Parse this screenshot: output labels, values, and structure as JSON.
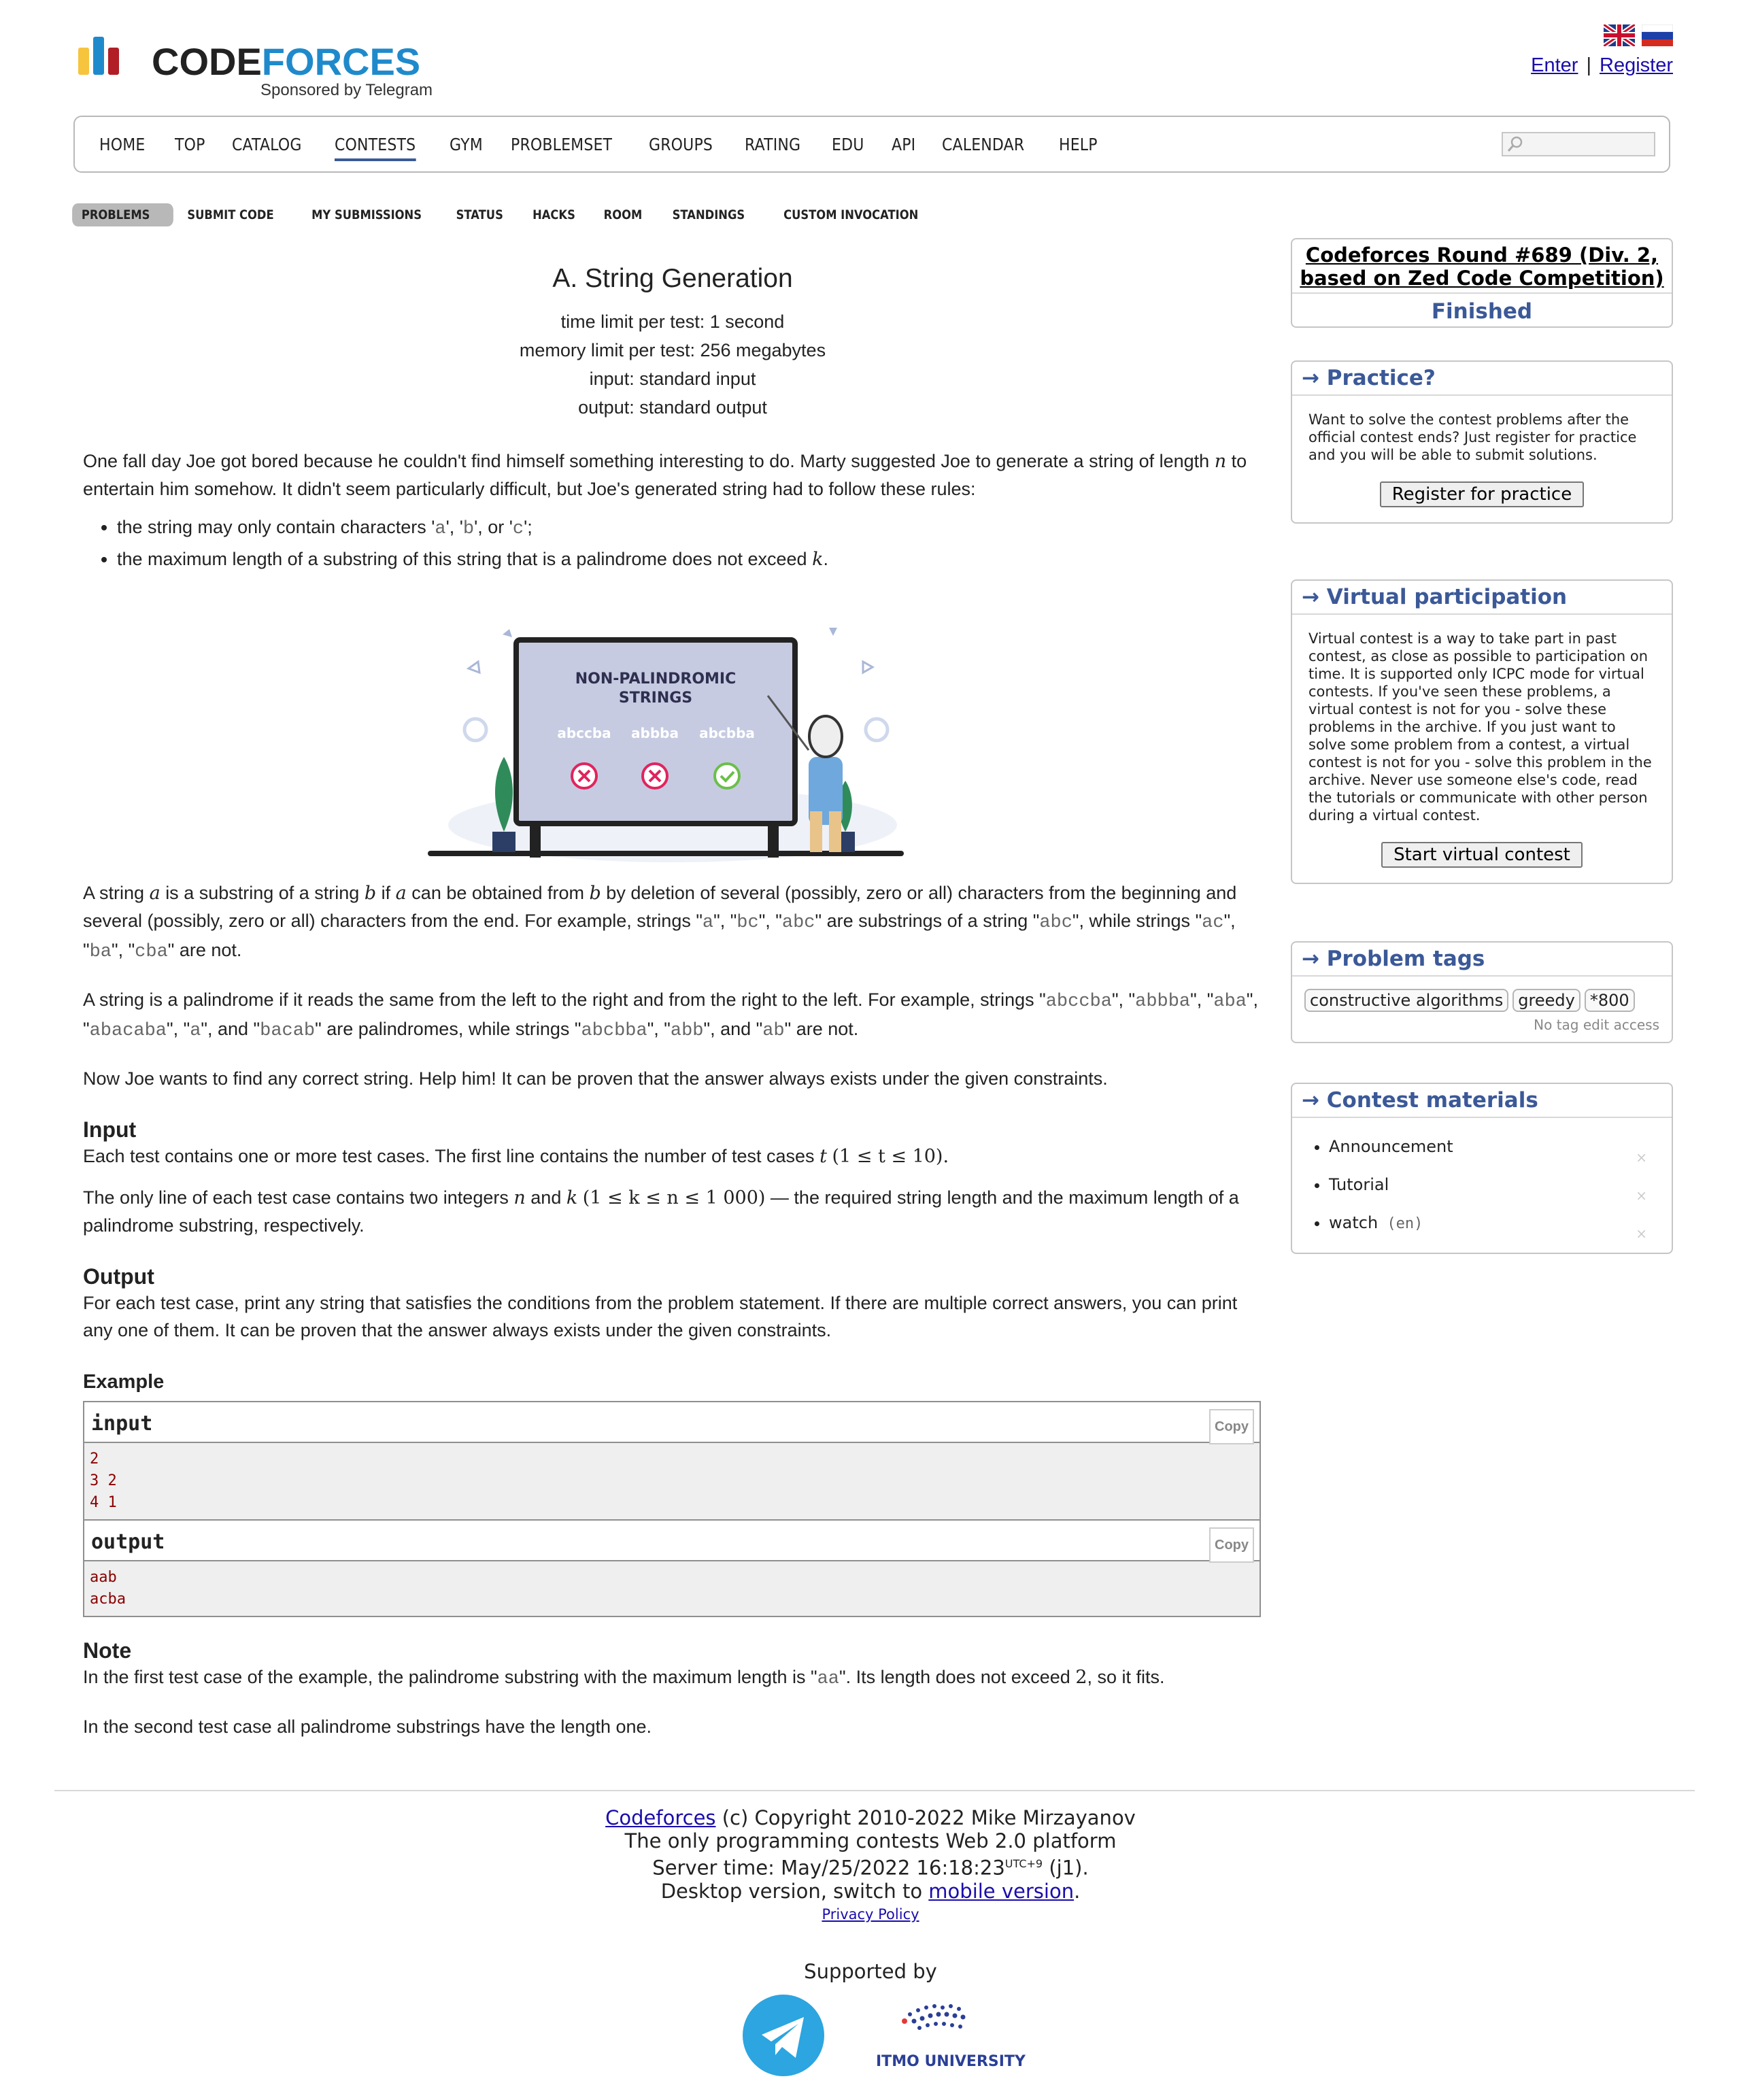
{
  "header": {
    "logo_text": "CODEFORCES",
    "logo_sponsor": "Sponsored by Telegram",
    "enter": "Enter",
    "separator": "|",
    "register": "Register"
  },
  "menu": [
    "HOME",
    "TOP",
    "CATALOG",
    "CONTESTS",
    "GYM",
    "PROBLEMSET",
    "GROUPS",
    "RATING",
    "EDU",
    "API",
    "CALENDAR",
    "HELP"
  ],
  "menu_active": "CONTESTS",
  "submenu": [
    "PROBLEMS",
    "SUBMIT CODE",
    "MY SUBMISSIONS",
    "STATUS",
    "HACKS",
    "ROOM",
    "STANDINGS",
    "CUSTOM INVOCATION"
  ],
  "submenu_active": "PROBLEMS",
  "problem": {
    "title": "A. String Generation",
    "time_limit": "time limit per test: 1 second",
    "memory_limit": "memory limit per test: 256 megabytes",
    "input_file": "input: standard input",
    "output_file": "output: standard output",
    "legend_1": "One fall day Joe got bored because he couldn't find himself something interesting to do. Marty suggested Joe to generate a string of length",
    "legend_n": "n",
    "legend_2": "to entertain him somehow. It didn't seem particularly difficult, but Joe's generated string had to follow these rules:",
    "rule_1a": "the string may only contain characters '",
    "rule_1_a": "a",
    "rule_1_sep1": "', '",
    "rule_1_b": "b",
    "rule_1_sep2": "', or '",
    "rule_1_c": "c",
    "rule_1_end": "';",
    "rule_2": "the maximum length of a substring of this string that is a palindrome does not exceed",
    "rule_2_k": "k",
    "rule_2_end": ".",
    "figure": {
      "board_title_1": "NON-PALINDROMIC",
      "board_title_2": "STRINGS",
      "word_1": "abccba",
      "word_2": "abbba",
      "word_3": "abcbba"
    },
    "substring_def": {
      "t1": "A string",
      "a": "a",
      "t2": "is a substring of a string",
      "b": "b",
      "t3": "if",
      "a2": "a",
      "t4": "can be obtained from",
      "b2": "b",
      "t5": "by deletion of several (possibly, zero or all) characters from the beginning and several (possibly, zero or all) characters from the end. For example, strings \"",
      "s1": "a",
      "t6": "\", \"",
      "s2": "bc",
      "t7": "\", \"",
      "s3": "abc",
      "t8": "\" are substrings of a string \"",
      "s4": "abc",
      "t9": "\", while strings \"",
      "s5": "ac",
      "t10": "\", \"",
      "s6": "ba",
      "t11": "\", \"",
      "s7": "cba",
      "t12": "\" are not."
    },
    "palindrome_def": {
      "t1": "A string is a palindrome if it reads the same from the left to the right and from the right to the left. For example, strings \"",
      "s1": "abccba",
      "t2": "\", \"",
      "s2": "abbba",
      "t3": "\", \"",
      "s3": "aba",
      "t4": "\", \"",
      "s4": "abacaba",
      "t5": "\", \"",
      "s5": "a",
      "t6": "\", and \"",
      "s6": "bacab",
      "t7": "\" are palindromes, while strings \"",
      "s7": "abcbba",
      "t8": "\", \"",
      "s8": "abb",
      "t9": "\", and \"",
      "s9": "ab",
      "t10": "\" are not."
    },
    "now_joe": "Now Joe wants to find any correct string. Help him! It can be proven that the answer always exists under the given constraints.",
    "input_title": "Input",
    "input_1": "Each test contains one or more test cases. The first line contains the number of test cases",
    "input_1_t": "t",
    "input_1_cons": "(1 ≤ t ≤ 10).",
    "input_2a": "The only line of each test case contains two integers",
    "input_2_n": "n",
    "input_2_and": "and",
    "input_2_k": "k",
    "input_2_cons": "(1 ≤ k ≤ n ≤ 1 000)",
    "input_2b": "— the required string length and the maximum length of a palindrome substring, respectively.",
    "output_title": "Output",
    "output_text": "For each test case, print any string that satisfies the conditions from the problem statement. If there are multiple correct answers, you can print any one of them. It can be proven that the answer always exists under the given constraints.",
    "example_title": "Example",
    "sample_input_label": "input",
    "sample_output_label": "output",
    "copy_label": "Copy",
    "sample_input": [
      "2",
      "3 2",
      "4 1"
    ],
    "sample_output": [
      "aab",
      "acba"
    ],
    "note_title": "Note",
    "note_1a": "In the first test case of the example, the palindrome substring with the maximum length is \"",
    "note_1_s": "aa",
    "note_1b": "\". Its length does not exceed",
    "note_1_num": "2",
    "note_1c": ", so it fits.",
    "note_2": "In the second test case all palindrome substrings have the length one."
  },
  "sidebar": {
    "contest_name": "Codeforces Round #689 (Div. 2, based on Zed Code Competition)",
    "contest_phase": "Finished",
    "practice_title": "→ Practice?",
    "practice_text": "Want to solve the contest problems after the official contest ends? Just register for practice and you will be able to submit solutions.",
    "practice_button": "Register for practice",
    "virtual_title": "→ Virtual participation",
    "virtual_text": "Virtual contest is a way to take part in past contest, as close as possible to participation on time. It is supported only ICPC mode for virtual contests. If you've seen these problems, a virtual contest is not for you - solve these problems in the archive. If you just want to solve some problem from a contest, a virtual contest is not for you - solve this problem in the archive. Never use someone else's code, read the tutorials or communicate with other person during a virtual contest.",
    "virtual_button": "Start virtual contest",
    "tags_title": "→ Problem tags",
    "tags": [
      "constructive algorithms",
      "greedy",
      "*800"
    ],
    "no_edit": "No tag edit access",
    "materials_title": "→ Contest materials",
    "materials": [
      "Announcement",
      "Tutorial",
      "watch"
    ],
    "materials_lang": "(en)",
    "remove_glyph": "×"
  },
  "footer": {
    "codeforces_link": "Codeforces",
    "copyright": "(c) Copyright 2010-2022 Mike Mirzayanov",
    "platform": "The only programming contests Web 2.0 platform",
    "server_time_label": "Server time: May/25/2022 16:18:23",
    "utc": "UTC+9",
    "server_suffix": "(j1).",
    "desktop": "Desktop version, switch to",
    "mobile_link": "mobile version",
    "period": ".",
    "privacy": "Privacy Policy",
    "supported_by": "Supported by",
    "itmo": "ITMO UNIVERSITY"
  },
  "colors": {
    "accent": "#3b5998",
    "link": "#1a0dab",
    "sample_text": "#8b0000"
  }
}
